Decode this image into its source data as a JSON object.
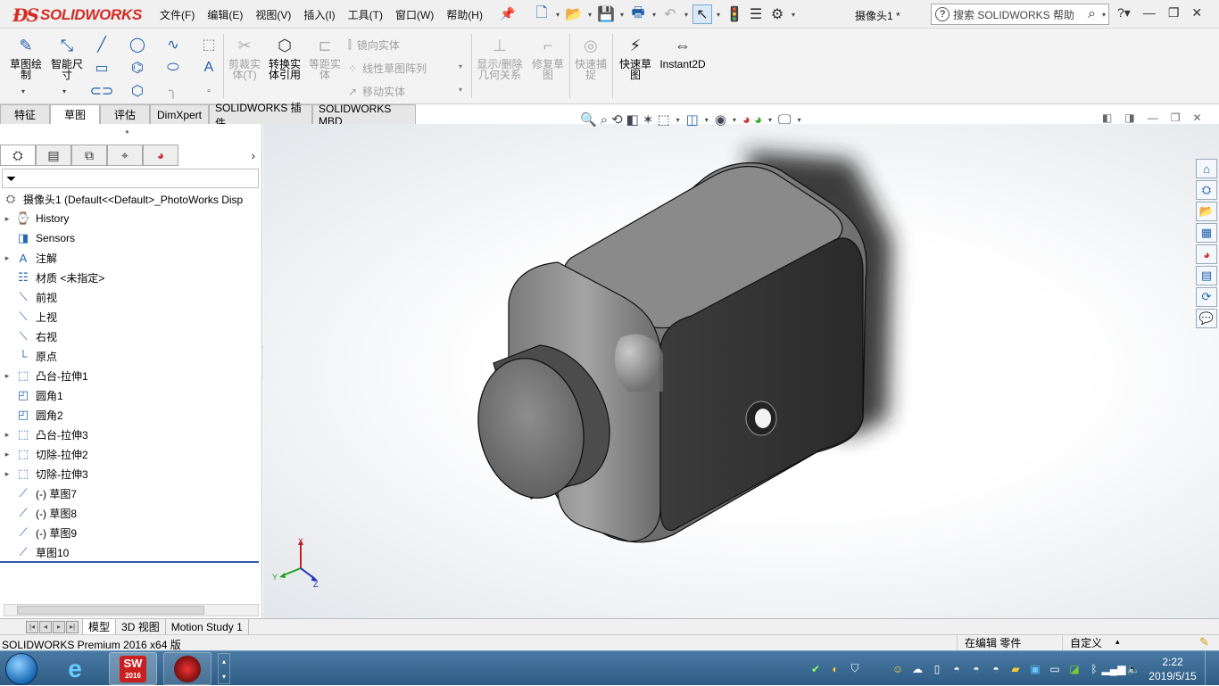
{
  "app": {
    "logo": "SOLIDWORKS",
    "document_title": "摄像头1 *"
  },
  "menus": [
    "文件(F)",
    "编辑(E)",
    "视图(V)",
    "插入(I)",
    "工具(T)",
    "窗口(W)",
    "帮助(H)"
  ],
  "search": {
    "placeholder": "搜索 SOLIDWORKS 帮助"
  },
  "command_manager": {
    "sketch": "草图绘制",
    "smart_dim": "智能尺寸",
    "trim": "剪裁实体(T)",
    "convert": "转换实体引用",
    "offset": "等距实体",
    "mirror": "镜向实体",
    "linear_pattern": "线性草图阵列",
    "move": "移动实体",
    "display_relations": "显示/删除几何关系",
    "repair": "修复草图",
    "quick_snap": "快速捕捉",
    "rapid_sketch": "快速草图",
    "instant2d": "Instant2D"
  },
  "tabs": [
    "特征",
    "草图",
    "评估",
    "DimXpert",
    "SOLIDWORKS 插件",
    "SOLIDWORKS MBD"
  ],
  "active_tab": "草图",
  "tree": {
    "root": "摄像头1  (Default<<Default>_PhotoWorks Disp",
    "items": [
      {
        "label": "History",
        "arrow": true,
        "icon": "history-icon"
      },
      {
        "label": "Sensors",
        "arrow": false,
        "icon": "sensors-icon"
      },
      {
        "label": "注解",
        "arrow": true,
        "icon": "annotations-icon"
      },
      {
        "label": "材质 <未指定>",
        "arrow": false,
        "icon": "material-icon"
      },
      {
        "label": "前视",
        "arrow": false,
        "icon": "plane-icon"
      },
      {
        "label": "上视",
        "arrow": false,
        "icon": "plane-icon"
      },
      {
        "label": "右视",
        "arrow": false,
        "icon": "plane-icon"
      },
      {
        "label": "原点",
        "arrow": false,
        "icon": "origin-icon"
      },
      {
        "label": "凸台-拉伸1",
        "arrow": true,
        "icon": "extrude-icon"
      },
      {
        "label": "圆角1",
        "arrow": false,
        "icon": "fillet-icon"
      },
      {
        "label": "圆角2",
        "arrow": false,
        "icon": "fillet-icon"
      },
      {
        "label": "凸台-拉伸3",
        "arrow": true,
        "icon": "extrude-icon"
      },
      {
        "label": "切除-拉伸2",
        "arrow": true,
        "icon": "cut-extrude-icon"
      },
      {
        "label": "切除-拉伸3",
        "arrow": true,
        "icon": "cut-extrude-icon"
      },
      {
        "label": "(-) 草图7",
        "arrow": false,
        "icon": "sketch-icon"
      },
      {
        "label": "(-) 草图8",
        "arrow": false,
        "icon": "sketch-icon"
      },
      {
        "label": "(-) 草图9",
        "arrow": false,
        "icon": "sketch-icon"
      },
      {
        "label": "草图10",
        "arrow": false,
        "icon": "sketch-icon"
      }
    ]
  },
  "bottom_tabs": [
    "模型",
    "3D 视图",
    "Motion Study 1"
  ],
  "triad": {
    "x": "X",
    "y": "Y",
    "z": "Z"
  },
  "status": {
    "left": "SOLIDWORKS Premium 2016 x64 版",
    "mode": "在编辑 零件",
    "units": "自定义"
  },
  "taskbar": {
    "sw_label": "SW",
    "sw_year": "2016",
    "time": "2:22",
    "date": "2019/5/15"
  }
}
